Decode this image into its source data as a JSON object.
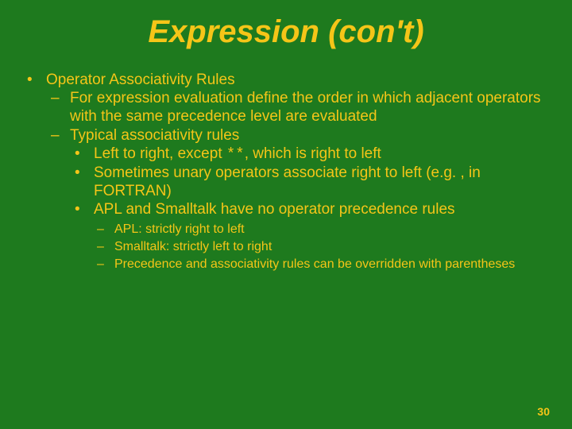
{
  "title": "Expression (con't)",
  "bullets": {
    "l1_0": "Operator Associativity Rules",
    "l2_0": "For expression evaluation define the order in which adjacent operators with the same precedence level are evaluated",
    "l2_1": "Typical associativity rules",
    "l3_0_a": "Left to right, except ",
    "l3_0_code": "**",
    "l3_0_b": ", which is right to left",
    "l3_1": "Sometimes unary operators associate right to left (e.g. , in FORTRAN)",
    "l3_2": "APL and Smalltalk have no operator precedence rules",
    "l4_0": "APL: strictly right to left",
    "l4_1": "Smalltalk: strictly left to right",
    "l4_2": "Precedence and associativity rules can be overridden with parentheses"
  },
  "page_number": "30"
}
